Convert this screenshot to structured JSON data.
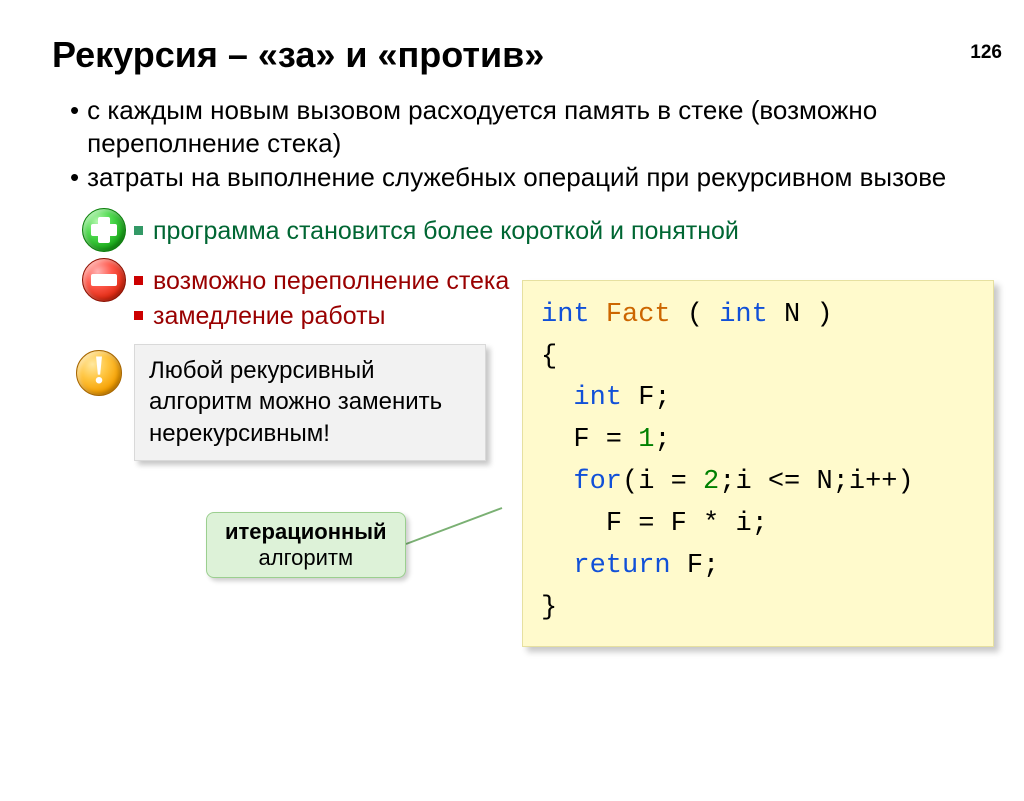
{
  "page_number": "126",
  "title": "Рекурсия – «за» и «против»",
  "bullets": [
    "с каждым новым вызовом расходуется память в стеке (возможно переполнение стека)",
    "затраты на выполнение служебных операций при рекурсивном вызове"
  ],
  "pros": [
    "программа становится более короткой и понятной"
  ],
  "cons": [
    "возможно переполнение стека",
    "замедление работы"
  ],
  "note": "Любой рекурсивный алгоритм можно заменить нерекурсивным!",
  "label": {
    "bold": "итерационный",
    "rest": "алгоритм"
  },
  "code": {
    "kw_int": "int",
    "fn_name": "Fact",
    "param_n": "N",
    "var_f": "F",
    "lit_1": "1",
    "lit_2": "2",
    "kw_for": "for",
    "var_i": "i",
    "kw_return": "return",
    "open": "(",
    "close": ")",
    "lb": "{",
    "rb": "}",
    "semi": ";",
    "assign": " = ",
    "le": " <= ",
    "pp": "++",
    "mul": " * ",
    "sp": " "
  }
}
